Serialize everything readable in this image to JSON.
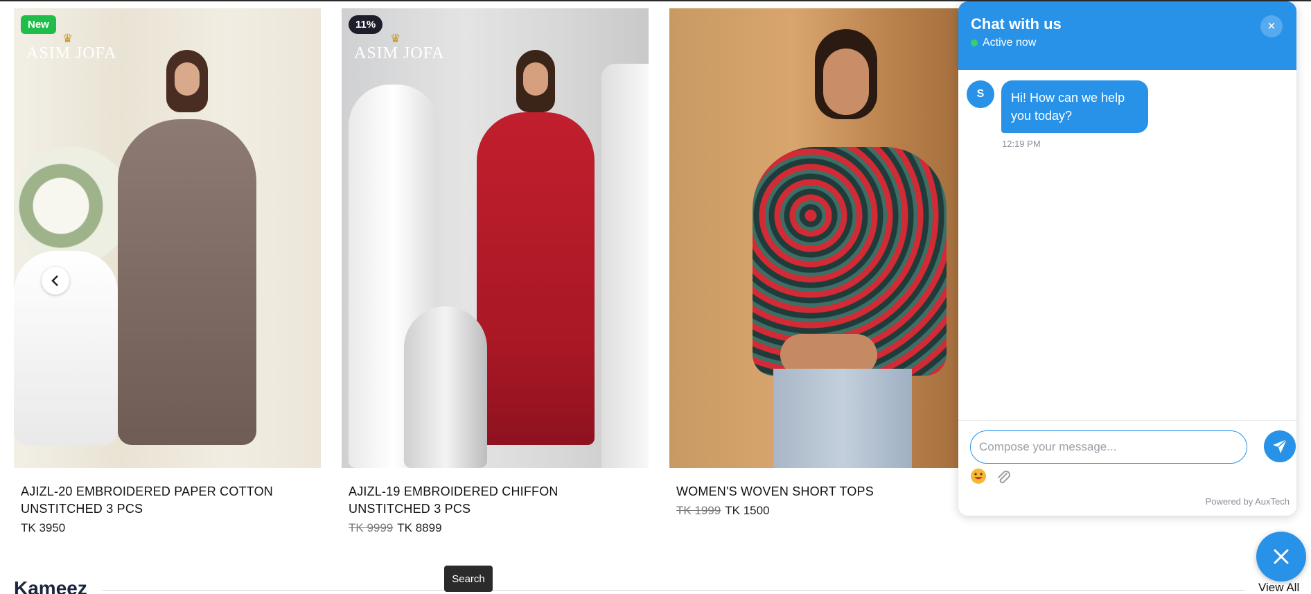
{
  "products": [
    {
      "badge": "New",
      "brand": "ASIM JOFA",
      "title": "AJIZL-20 EMBROIDERED PAPER COTTON UNSTITCHED 3 PCS",
      "old_price": "",
      "price": "TK 3950"
    },
    {
      "badge": "11%",
      "brand": "ASIM JOFA",
      "title": "AJIZL-19 EMBROIDERED CHIFFON UNSTITCHED 3 PCS",
      "old_price": "TK 9999",
      "price": "TK 8899"
    },
    {
      "badge": "",
      "brand": "",
      "title": "WOMEN'S WOVEN SHORT TOPS",
      "old_price": "TK 1999",
      "price": "TK 1500"
    }
  ],
  "carousel": {
    "prev_icon": "chevron-left-icon"
  },
  "section": {
    "title": "Kameez",
    "view_all": "View All"
  },
  "tooltip": "Search",
  "chat": {
    "title": "Chat with us",
    "status": "Active now",
    "agent_initial": "S",
    "message": "Hi! How can we help you today?",
    "message_time": "12:19 PM",
    "compose_placeholder": "Compose your message...",
    "powered_by": "Powered by AuxTech",
    "accent_color": "#2792e8"
  },
  "colors": {
    "new_badge": "#1fbe4b",
    "discount_badge": "#1e1e2a"
  }
}
